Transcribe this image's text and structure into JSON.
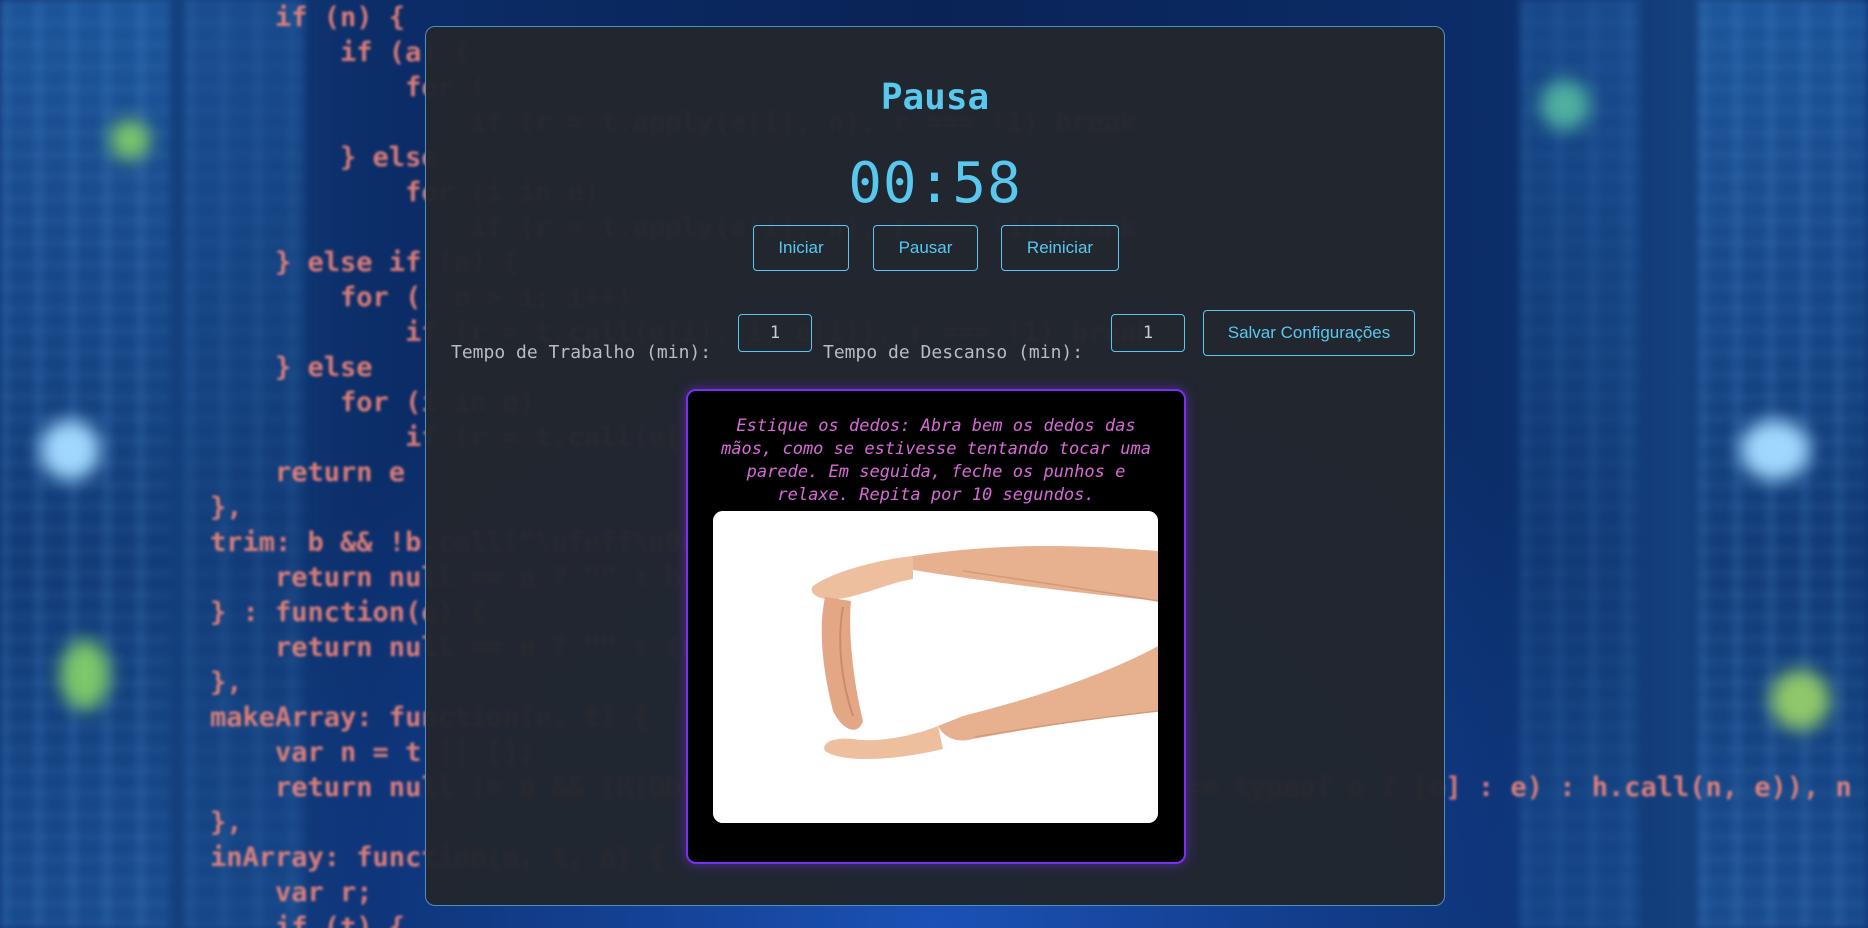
{
  "header": {
    "title": "Pausa",
    "timer": "00:58"
  },
  "controls": {
    "start_label": "Iniciar",
    "pause_label": "Pausar",
    "reset_label": "Reiniciar"
  },
  "settings": {
    "work_label": "Tempo de Trabalho (min):",
    "work_value": "1",
    "rest_label": "Tempo de Descanso (min):",
    "rest_value": "1",
    "save_label": "Salvar Configurações"
  },
  "exercise": {
    "text": "Estique os dedos: Abra bem os dedos das mãos, como se estivesse tentando tocar uma parede. Em seguida, feche os punhos e relaxe. Repita por 10 segundos.",
    "image": "hands-stretch-photo"
  },
  "background": {
    "code_lines": [
      "    if (n) {",
      "        if (a) {",
      "            for (",
      "                if (r = t.apply(e[i], n), r === !1) break",
      "        } else",
      "            for (i in e)",
      "                if (r = t.apply(e[i], n), r === !1) break",
      "    } else if (a) {",
      "        for (; o > i; i++)",
      "            if (r = t.call(e[i], i, e[i]), r === !1) break",
      "    } else",
      "        for (i in e)",
      "            if (r = t.call(e[i], i, e[i]), r === !1) break",
      "    return e",
      "},",
      "trim: b && !b.call(\"\\ufeff\\u00a0\") ? function(e) {",
      "    return null == e ? \"\" : b.call(e)",
      "} : function(e) {",
      "    return null == e ? \"\" : (e + \"\").replace(C, \"\")",
      "},",
      "makeArray: function(e, t) {",
      "    var n = t || [];",
      "    return null != e && (M(Object(e)) ? x.merge(n, \"string\" == typeof e ? [e] : e) : h.call(n, e)), n",
      "},",
      "inArray: function(e, t, n) {",
      "    var r;",
      "    if (t) {"
    ]
  },
  "colors": {
    "accent": "#59c8ef",
    "panel": "#22262d",
    "card_border": "#7b2ff0",
    "exercise_text": "#d86ad8"
  }
}
